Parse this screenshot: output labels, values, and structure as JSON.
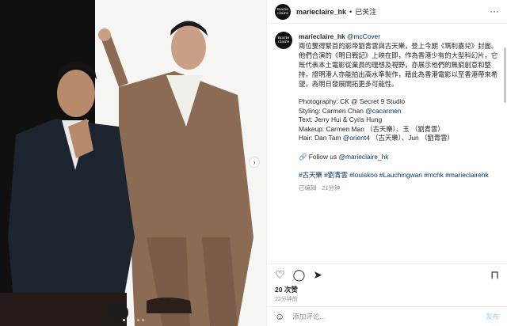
{
  "header": {
    "avatar_text": "marie claire",
    "username": "marieclaire_hk",
    "separator": "•",
    "follow_label": "已关注",
    "more_icon": "more-horizontal-icon"
  },
  "caption": {
    "avatar_text": "marie claire",
    "username": "marieclaire_hk",
    "mention": "@mcCover",
    "paragraph": "兩位雙得緊首的影帝劉青雲與古天樂，登上今期《瑪利嘉兒》封面。他們合演的《明日戰記》上映在即，作為香港少有的大型科幻片，它既代表本土電影從業員的理想及視野，亦展示他們的無窮創意和堅持，證明港人亦能拍出高水準製作，藉此為香港電影以至香港帶來希望，為明日發展開拓更多可能性。",
    "credits": [
      {
        "text": "Photography: CK @ Secret 9 Studio",
        "tag": ""
      },
      {
        "text": "Styling: Carmen Chan ",
        "tag": "@cacarmen"
      },
      {
        "text": "Text: Jerry Hui & Cyris Hung",
        "tag": ""
      },
      {
        "text": "Makeup: Carmen Man （古天樂）、玉 （劉青雲）",
        "tag": ""
      },
      {
        "text": "Hair: Dan Tam ",
        "tag": "@orient4",
        "suffix": " （古天樂）、Jun （劉青雲）"
      }
    ],
    "follow_text": "🔗 Follow us ",
    "follow_tag": "@marieclaire_hk",
    "hashtags": "#古天樂 #劉青雲 #louiskoo #Lauchingwan #mchk #marieclairehk",
    "meta": "已编辑 · 21分钟"
  },
  "actions": {
    "like_icon": "heart-icon",
    "comment_icon": "comment-icon",
    "share_icon": "share-icon",
    "save_icon": "bookmark-icon"
  },
  "likes_label": "20 次赞",
  "time_label": "22分钟前",
  "add_comment": {
    "emoji_icon": "emoji-icon",
    "placeholder": "添加评论...",
    "post_label": "发布"
  },
  "photo": {
    "slide_count": 5,
    "active_slide": 1,
    "next_icon": "chevron-right-icon"
  },
  "colors": {
    "link": "#00376b",
    "muted": "#8e8e8e",
    "post_button": "#b2dffc"
  }
}
